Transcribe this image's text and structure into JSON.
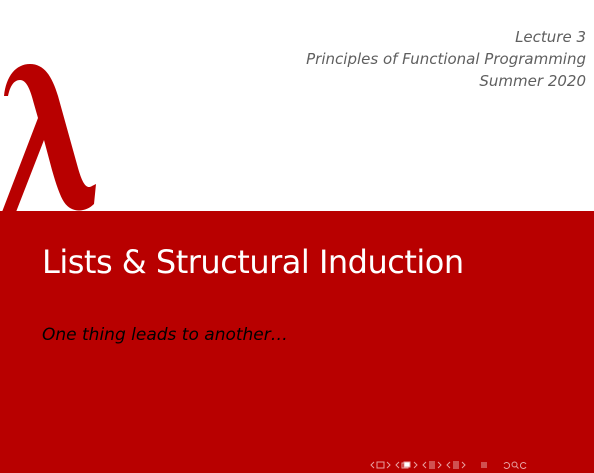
{
  "header": {
    "lecture": "Lecture 3",
    "course": "Principles of Functional Programming",
    "term": "Summer 2020"
  },
  "title": "Lists & Structural Induction",
  "subtitle": "One thing leads to another…",
  "logo": {
    "glyph": "λ",
    "color": "#b80000"
  },
  "colors": {
    "accent": "#b80000",
    "band_text": "#ffffff",
    "header_text": "#5f5f5f",
    "nav_icons": "#e8a0a0"
  },
  "navigation": {
    "icons": [
      "nav-frame-icon",
      "nav-subsection-icon",
      "nav-section-icon",
      "nav-presentation-icon",
      "nav-appendix-icon",
      "nav-search-icon"
    ]
  }
}
